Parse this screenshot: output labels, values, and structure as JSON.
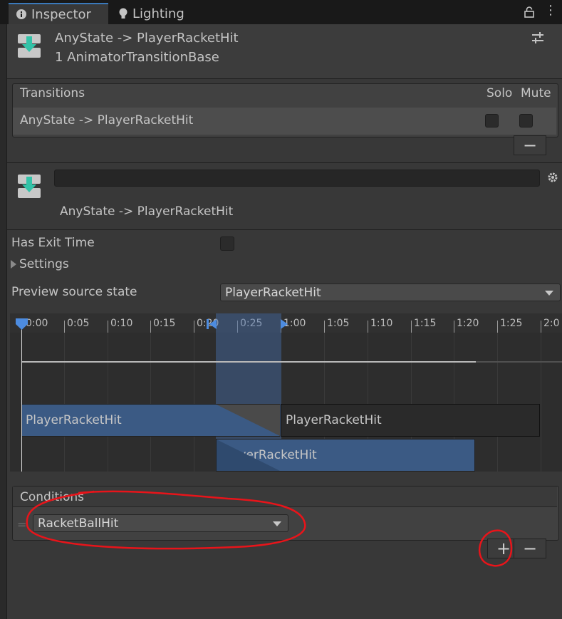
{
  "tabs": [
    {
      "label": "Inspector",
      "icon": "info-icon",
      "active": true
    },
    {
      "label": "Lighting",
      "icon": "lightbulb-icon",
      "active": false
    }
  ],
  "header": {
    "title": "AnyState -> PlayerRacketHit",
    "subtitle": "1 AnimatorTransitionBase"
  },
  "transitions": {
    "header_label": "Transitions",
    "solo_label": "Solo",
    "mute_label": "Mute",
    "row_label": "AnyState -> PlayerRacketHit",
    "remove_symbol": "−"
  },
  "transition_detail": {
    "name_value": "",
    "label": "AnyState -> PlayerRacketHit"
  },
  "properties": {
    "has_exit_time_label": "Has Exit Time",
    "has_exit_time_checked": false,
    "settings_label": "Settings",
    "preview_label": "Preview source state",
    "preview_value": "PlayerRacketHit"
  },
  "timeline": {
    "ticks": [
      "0:00",
      "0:05",
      "0:10",
      "0:15",
      "0:20",
      "0:25",
      "1:00",
      "1:05",
      "1:10",
      "1:15",
      "1:20",
      "1:25",
      "2:0"
    ],
    "clip_source": "PlayerRacketHit",
    "clip_dest_top": "PlayerRacketHit",
    "clip_dest_bottom": "PlayerRacketHit"
  },
  "conditions": {
    "header_label": "Conditions",
    "condition_value": "RacketBallHit",
    "add_symbol": "+",
    "remove_symbol": "−"
  },
  "colors": {
    "accent": "#3a79bb",
    "annotation": "#e8141a",
    "clip_blue": "#3b5a84"
  }
}
